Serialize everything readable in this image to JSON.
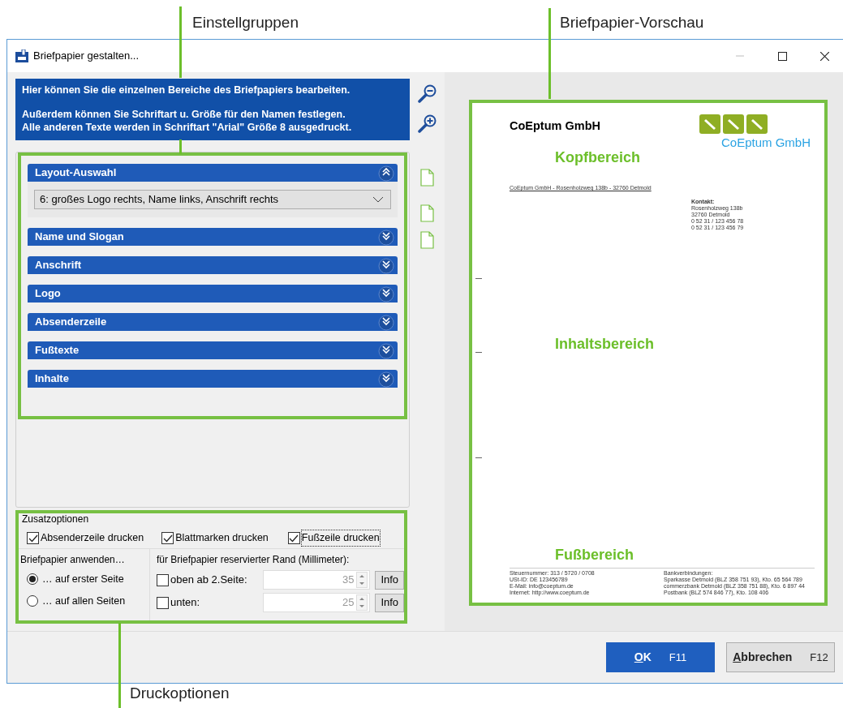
{
  "callouts": [
    {
      "label": "Einstellgruppen"
    },
    {
      "label": "Briefpapier-Vorschau"
    },
    {
      "label": "Druckoptionen"
    }
  ],
  "window": {
    "title": "Briefpapier gestalten..."
  },
  "info": [
    [
      "Hier können Sie die einzelnen Bereiche des Briefpapiers bearbeiten."
    ],
    [
      "Außerdem können Sie Schriftart u. Größe für den Namen festlegen.",
      "Alle anderen Texte werden in Schriftart \"Arial\" Größe 8 ausgedruckt."
    ]
  ],
  "groups": [
    {
      "title": "Layout-Auswahl",
      "expanded": true,
      "value": "6: großes Logo rechts, Name links, Anschrift rechts"
    },
    {
      "title": "Name und Slogan",
      "expanded": false
    },
    {
      "title": "Anschrift",
      "expanded": false
    },
    {
      "title": "Logo",
      "expanded": false
    },
    {
      "title": "Absenderzeile",
      "expanded": false
    },
    {
      "title": "Fußtexte",
      "expanded": false
    },
    {
      "title": "Inhalte",
      "expanded": false
    }
  ],
  "options": {
    "title": "Zusatzoptionen",
    "checks": [
      {
        "label": "Absenderzeile drucken",
        "checked": true,
        "focused": false
      },
      {
        "label": "Blattmarken drucken",
        "checked": true,
        "focused": false
      },
      {
        "label": "Fußzeile drucken",
        "checked": true,
        "focused": true
      }
    ],
    "apply": {
      "title": "Briefpapier anwenden…",
      "radios": [
        {
          "label": "… auf erster Seite",
          "selected": true
        },
        {
          "label": "… auf allen Seiten",
          "selected": false
        }
      ]
    },
    "margin": {
      "title": "für Briefpapier reservierter Rand (Millimeter):",
      "rows": [
        {
          "label": "oben ab 2.Seite:",
          "checked": false,
          "value": "35",
          "button": "Info"
        },
        {
          "label": "unten:",
          "checked": false,
          "value": "25",
          "button": "Info"
        }
      ]
    }
  },
  "preview": {
    "company": "CoEptum GmbH",
    "logo_text": "CoEptum GmbH",
    "sender_line": "CoEptum GmbH - Rosenholzweg 138b - 32760 Detmold",
    "contact": [
      "Kontakt:",
      "Rosenholzweg 138b",
      "32760 Detmold",
      "0 52 31 / 123 456 78",
      "0 52 31 / 123 456 79"
    ],
    "footer_left": [
      "Steuernummer: 313 / 5720 / 0708",
      "USt-ID: DE 123456789",
      "E-Mail: info@coeptum.de",
      "Internet: http://www.coeptum.de"
    ],
    "footer_right": [
      "Bankverbindungen:",
      "Sparkasse Detmold (BLZ 358 751 93), Kto. 65 564 789",
      "commerzbank Detmold (BLZ 358 751 88), Kto. 6 897 44",
      "Postbank (BLZ 574 846 77), Kto. 108 406"
    ],
    "areas": [
      "Kopfbereich",
      "Inhaltsbereich",
      "Fußbereich"
    ]
  },
  "buttons": [
    {
      "label": "OK",
      "key": "F11",
      "primary": true
    },
    {
      "label": "Abbrechen",
      "key": "F12",
      "primary": false
    }
  ]
}
